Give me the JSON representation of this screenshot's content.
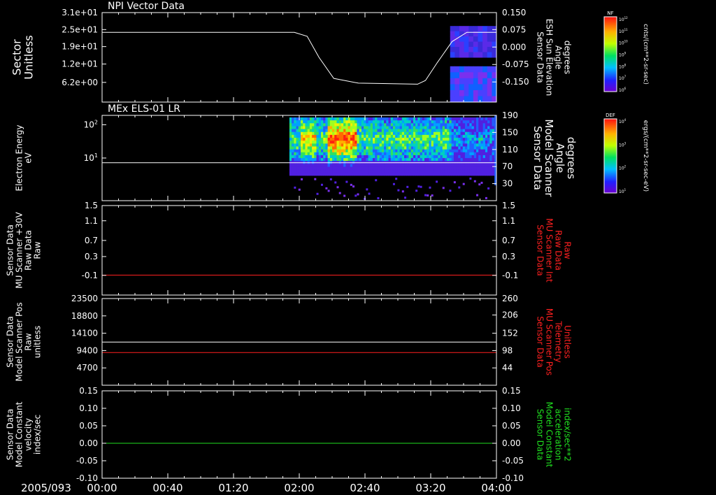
{
  "colors": {
    "background": "#000000",
    "axis": "#ffffff",
    "red": "#ff2020",
    "green": "#20e020"
  },
  "time_axis": {
    "date_label": "2005/093",
    "ticks": [
      "00:00",
      "00:40",
      "01:20",
      "02:00",
      "02:40",
      "03:20",
      "04:00"
    ],
    "range_hours": [
      0,
      4
    ]
  },
  "colorbars": [
    {
      "title": "NF",
      "unit": "cnts/(cm**2-sr-sec)",
      "tick_labels": [
        "10^12",
        "10^11",
        "10^10",
        "10^9",
        "10^8",
        "10^7",
        "10^6"
      ]
    },
    {
      "title": "DEF",
      "unit": "ergs/(cm**2-sr-sec-eV)",
      "tick_labels": [
        "10^4",
        "10^3",
        "10^2",
        "10^1"
      ]
    }
  ],
  "panels": [
    {
      "id": "npi",
      "title": "NPI Vector Data",
      "left_label": [
        "Sector",
        "Unitless"
      ],
      "left_ticks": [
        "3.1e+01",
        "2.5e+01",
        "1.9e+01",
        "1.2e+01",
        "6.2e+00"
      ],
      "right_label": [
        "Sensor Data",
        "ESH Sun Elevation",
        "Angle",
        "degrees"
      ],
      "right_ticks": [
        "0.150",
        "0.075",
        "0.000",
        "-0.075",
        "-0.150"
      ],
      "right_color": "#ffffff"
    },
    {
      "id": "els",
      "title": "MEx ELS-01 LR",
      "left_label": [
        "Electron Energy",
        "eV"
      ],
      "left_ticks": [
        "10^2",
        "10^1"
      ],
      "right_label": [
        "Sensor Data",
        "Model Scanner",
        "Angle",
        "degrees"
      ],
      "right_ticks": [
        "190",
        "150",
        "110",
        "70",
        "30"
      ],
      "right_color": "#ffffff"
    },
    {
      "id": "scan30",
      "title": "",
      "left_label": [
        "Sensor Data",
        "MU Scanner +30V",
        "Raw Data",
        "Raw"
      ],
      "left_ticks": [
        "1.5",
        "1.1",
        "0.7",
        "0.3",
        "-0.1"
      ],
      "right_label": [
        "Sensor Data",
        "MU Scanner Int",
        "Raw Data",
        "Raw"
      ],
      "right_ticks": [
        "1.5",
        "1.1",
        "0.7",
        "0.3",
        "-0.1"
      ],
      "right_color": "#ff2020"
    },
    {
      "id": "scanpos",
      "title": "",
      "left_label": [
        "Sensor Data",
        "Model Scanner Pos",
        "Raw",
        "unitless"
      ],
      "left_ticks": [
        "23500",
        "18800",
        "14100",
        "9400",
        "4700"
      ],
      "right_label": [
        "Sensor Data",
        "MU Scanner Pos",
        "Telemetry",
        "Unitless"
      ],
      "right_ticks": [
        "260",
        "206",
        "152",
        "98",
        "44"
      ],
      "right_color": "#ff2020"
    },
    {
      "id": "const",
      "title": "",
      "left_label": [
        "Sensor Data",
        "Model Constant",
        "velocity",
        "index/sec"
      ],
      "left_ticks": [
        "0.15",
        "0.10",
        "0.05",
        "0.00",
        "-0.05",
        "-0.10"
      ],
      "right_label": [
        "Sensor Data",
        "Model Constant",
        "acceleration",
        "index/sec**2"
      ],
      "right_ticks": [
        "0.15",
        "0.10",
        "0.05",
        "0.00",
        "-0.05",
        "-0.10"
      ],
      "right_color": "#20e020"
    }
  ],
  "chart_data": [
    {
      "type": "line",
      "panel": "npi",
      "title": "NPI Vector Data",
      "x_unit": "hours",
      "xlim": [
        0,
        4
      ],
      "ylim": [
        -0.19,
        0.15
      ],
      "series": [
        {
          "axis": "right",
          "color": "#ffffff",
          "x": [
            0,
            1.95,
            2.08,
            2.2,
            2.35,
            2.6,
            3.2,
            3.28,
            3.4,
            3.55,
            3.7,
            4
          ],
          "y": [
            0.075,
            0.075,
            0.06,
            -0.02,
            -0.1,
            -0.118,
            -0.122,
            -0.108,
            -0.04,
            0.04,
            0.075,
            0.075
          ]
        }
      ],
      "spectrogram_blocks": [
        {
          "x": [
            3.53,
            4.0
          ],
          "y_fraction": [
            0.5,
            0.85
          ],
          "colors": [
            "#5a2ae8",
            "#3a2ad8",
            "#2a40ff"
          ]
        },
        {
          "x": [
            3.53,
            4.0
          ],
          "y_fraction": [
            0.0,
            0.4
          ],
          "colors": [
            "#7a30ee",
            "#4a40ff",
            "#1060ff"
          ]
        }
      ]
    },
    {
      "type": "heatmap",
      "panel": "els",
      "title": "MEx ELS-01 LR",
      "x_unit": "hours",
      "xlim": [
        0,
        4
      ],
      "ylabel": "Electron Energy eV",
      "data_interval": [
        1.9,
        4.0
      ],
      "series": [
        {
          "axis": "right",
          "color": "#ffffff",
          "x": [
            0,
            4
          ],
          "y": [
            90,
            90
          ]
        }
      ]
    },
    {
      "type": "line",
      "panel": "scan30",
      "xlim": [
        0,
        4
      ],
      "ylim": [
        -0.3,
        1.5
      ],
      "series": [
        {
          "axis": "right",
          "color": "#ff2020",
          "x": [
            0,
            4
          ],
          "y": [
            0.1,
            0.1
          ]
        }
      ]
    },
    {
      "type": "line",
      "panel": "scanpos",
      "xlim": [
        0,
        4
      ],
      "ylim": [
        0,
        23500
      ],
      "series": [
        {
          "axis": "left",
          "color": "#ffffff",
          "x": [
            0,
            4
          ],
          "y": [
            11700,
            11700
          ]
        },
        {
          "axis": "left",
          "color": "#ff2020",
          "x": [
            0,
            4
          ],
          "y": [
            8850,
            8850
          ]
        }
      ]
    },
    {
      "type": "line",
      "panel": "const",
      "xlim": [
        0,
        4
      ],
      "ylim": [
        -0.1,
        0.15
      ],
      "series": [
        {
          "axis": "left",
          "color": "#20e020",
          "x": [
            0,
            4
          ],
          "y": [
            0.0,
            0.0
          ]
        }
      ]
    }
  ]
}
